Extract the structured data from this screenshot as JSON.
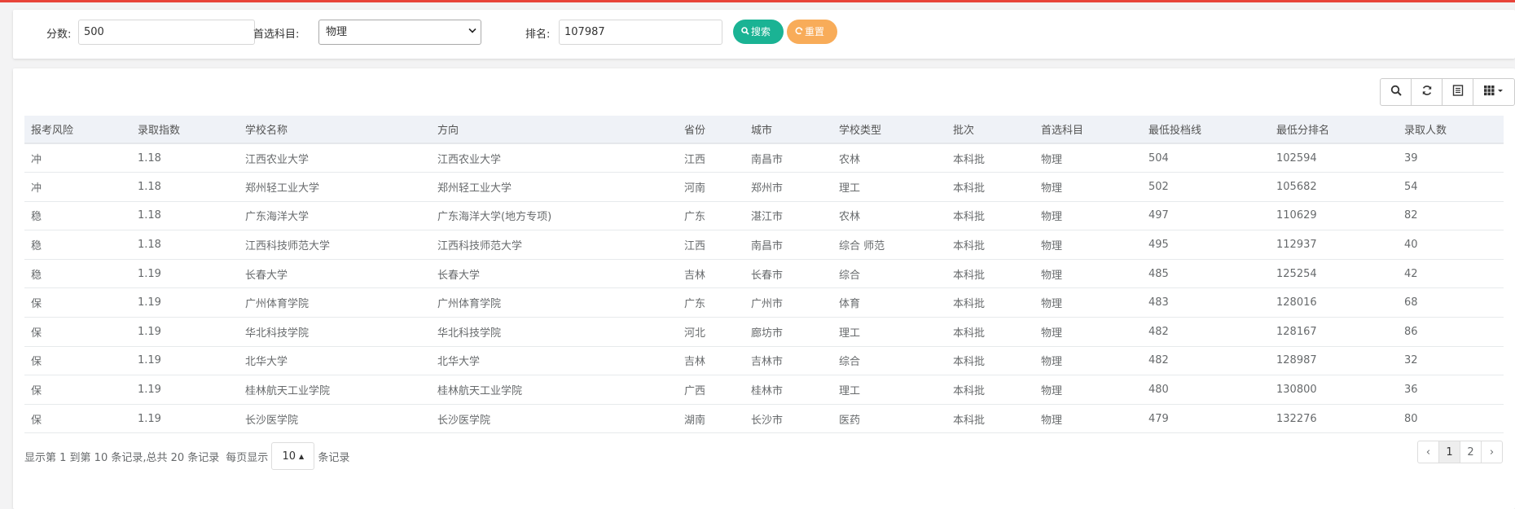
{
  "search": {
    "score_label": "分数:",
    "score_value": "500",
    "subject_label": "首选科目:",
    "subject_value": "物理",
    "rank_label": "排名:",
    "rank_value": "107987",
    "search_button": "搜索",
    "reset_button": "重置"
  },
  "table": {
    "columns": [
      "报考风险",
      "录取指数",
      "学校名称",
      "方向",
      "省份",
      "城市",
      "学校类型",
      "批次",
      "首选科目",
      "最低投档线",
      "最低分排名",
      "录取人数"
    ],
    "rows": [
      [
        "冲",
        "1.18",
        "江西农业大学",
        "江西农业大学",
        "江西",
        "南昌市",
        "农林",
        "本科批",
        "物理",
        "504",
        "102594",
        "39"
      ],
      [
        "冲",
        "1.18",
        "郑州轻工业大学",
        "郑州轻工业大学",
        "河南",
        "郑州市",
        "理工",
        "本科批",
        "物理",
        "502",
        "105682",
        "54"
      ],
      [
        "稳",
        "1.18",
        "广东海洋大学",
        "广东海洋大学(地方专项)",
        "广东",
        "湛江市",
        "农林",
        "本科批",
        "物理",
        "497",
        "110629",
        "82"
      ],
      [
        "稳",
        "1.18",
        "江西科技师范大学",
        "江西科技师范大学",
        "江西",
        "南昌市",
        "综合 师范",
        "本科批",
        "物理",
        "495",
        "112937",
        "40"
      ],
      [
        "稳",
        "1.19",
        "长春大学",
        "长春大学",
        "吉林",
        "长春市",
        "综合",
        "本科批",
        "物理",
        "485",
        "125254",
        "42"
      ],
      [
        "保",
        "1.19",
        "广州体育学院",
        "广州体育学院",
        "广东",
        "广州市",
        "体育",
        "本科批",
        "物理",
        "483",
        "128016",
        "68"
      ],
      [
        "保",
        "1.19",
        "华北科技学院",
        "华北科技学院",
        "河北",
        "廊坊市",
        "理工",
        "本科批",
        "物理",
        "482",
        "128167",
        "86"
      ],
      [
        "保",
        "1.19",
        "北华大学",
        "北华大学",
        "吉林",
        "吉林市",
        "综合",
        "本科批",
        "物理",
        "482",
        "128987",
        "32"
      ],
      [
        "保",
        "1.19",
        "桂林航天工业学院",
        "桂林航天工业学院",
        "广西",
        "桂林市",
        "理工",
        "本科批",
        "物理",
        "480",
        "130800",
        "36"
      ],
      [
        "保",
        "1.19",
        "长沙医学院",
        "长沙医学院",
        "湖南",
        "长沙市",
        "医药",
        "本科批",
        "物理",
        "479",
        "132276",
        "80"
      ]
    ]
  },
  "pager": {
    "summary": "显示第 1 到第 10 条记录,总共 20 条记录",
    "per_page_prefix": "每页显示",
    "page_size": "10",
    "per_page_suffix": "条记录",
    "prev": "‹",
    "pages": [
      "1",
      "2"
    ],
    "next": "›"
  },
  "toolbar": {
    "icons": [
      "search-icon",
      "refresh-icon",
      "toggle-view-icon",
      "columns-icon"
    ]
  },
  "colors": {
    "accent_bar": "#e8443a",
    "search_button": "#1ab394",
    "reset_button": "#f8ac59"
  }
}
